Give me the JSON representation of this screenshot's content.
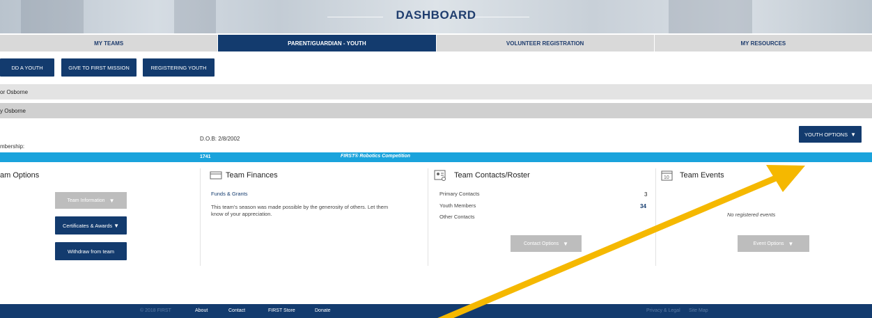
{
  "banner": {
    "title": "DASHBOARD"
  },
  "tabs": [
    {
      "label": "MY TEAMS"
    },
    {
      "label": "PARENT/GUARDIAN - YOUTH"
    },
    {
      "label": "VOLUNTEER REGISTRATION"
    },
    {
      "label": "MY RESOURCES"
    }
  ],
  "actions": {
    "add_youth": "DD A YOUTH",
    "give": "GIVE TO FIRST MISSION",
    "registering": "REGISTERING YOUTH"
  },
  "people": {
    "parent": "or Osborne",
    "youth": "y Osborne"
  },
  "youth": {
    "dob": "D.O.B: 2/8/2002",
    "membership": "mbership:",
    "options_label": "YOUTH OPTIONS"
  },
  "program": {
    "team_number": "1741",
    "name": "FIRST® Robotics Competition"
  },
  "team_options": {
    "title": "am Options",
    "info_btn": "Team Information",
    "certs_btn": "Certificates & Awards",
    "withdraw_btn": "Withdraw from team"
  },
  "finances": {
    "title": "Team Finances",
    "link": "Funds & Grants",
    "body_line1": "This team's season was made possible by the generosity of others. Let them",
    "body_line2": "know of your appreciation."
  },
  "contacts": {
    "title": "Team Contacts/Roster",
    "primary_label": "Primary Contacts",
    "primary_count": "3",
    "youth_label": "Youth Members",
    "youth_count": "34",
    "other_label": "Other Contacts",
    "options_btn": "Contact Options"
  },
  "events": {
    "title": "Team Events",
    "empty": "No registered events",
    "options_btn": "Event Options"
  },
  "footer": {
    "copyright": "© 2018 FIRST",
    "about": "About",
    "contact": "Contact",
    "store": "FIRST Store",
    "donate": "Donate",
    "privacy": "Privacy & Legal",
    "sitemap": "Site Map"
  },
  "colors": {
    "navy": "#133b6e",
    "program_blue": "#1aa3dc",
    "arrow": "#f5b800"
  }
}
